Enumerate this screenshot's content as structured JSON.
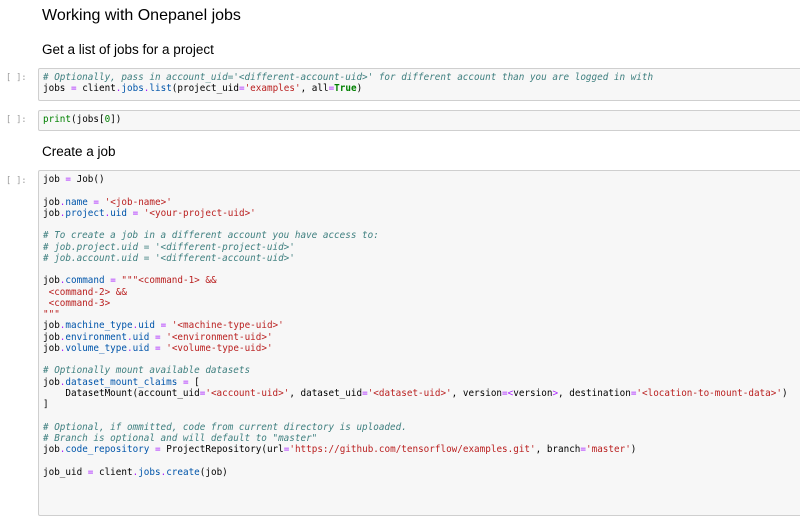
{
  "notebook": {
    "title": "Working with Onepanel jobs",
    "section_list_jobs": "Get a list of jobs for a project",
    "section_create_job": "Create a job",
    "prompt": "[ ]:",
    "cells": [
      {
        "lines": [
          [
            [
              "c",
              "# Optionally, pass in account_uid='<different-account-uid>' for different account than you are logged in with"
            ]
          ],
          [
            [
              "t",
              "jobs "
            ],
            [
              "o",
              "="
            ],
            [
              "t",
              " client"
            ],
            [
              "o",
              "."
            ],
            [
              "a",
              "jobs"
            ],
            [
              "o",
              "."
            ],
            [
              "a",
              "list"
            ],
            [
              "t",
              "(project_uid"
            ],
            [
              "o",
              "="
            ],
            [
              "s",
              "'examples'"
            ],
            [
              "t",
              ", all"
            ],
            [
              "o",
              "="
            ],
            [
              "k",
              "True"
            ],
            [
              "t",
              ")"
            ]
          ]
        ]
      },
      {
        "lines": [
          [
            [
              "b",
              "print"
            ],
            [
              "t",
              "(jobs["
            ],
            [
              "n",
              "0"
            ],
            [
              "t",
              "])"
            ]
          ]
        ]
      },
      {
        "lines": [
          [
            [
              "t",
              "job "
            ],
            [
              "o",
              "="
            ],
            [
              "t",
              " Job()"
            ]
          ],
          [],
          [
            [
              "t",
              "job"
            ],
            [
              "o",
              "."
            ],
            [
              "a",
              "name"
            ],
            [
              "t",
              " "
            ],
            [
              "o",
              "="
            ],
            [
              "t",
              " "
            ],
            [
              "s",
              "'<job-name>'"
            ]
          ],
          [
            [
              "t",
              "job"
            ],
            [
              "o",
              "."
            ],
            [
              "a",
              "project"
            ],
            [
              "o",
              "."
            ],
            [
              "a",
              "uid"
            ],
            [
              "t",
              " "
            ],
            [
              "o",
              "="
            ],
            [
              "t",
              " "
            ],
            [
              "s",
              "'<your-project-uid>'"
            ]
          ],
          [],
          [
            [
              "c",
              "# To create a job in a different account you have access to:"
            ]
          ],
          [
            [
              "c",
              "# job.project.uid = '<different-project-uid>'"
            ]
          ],
          [
            [
              "c",
              "# job.account.uid = '<different-account-uid>'"
            ]
          ],
          [],
          [
            [
              "t",
              "job"
            ],
            [
              "o",
              "."
            ],
            [
              "a",
              "command"
            ],
            [
              "t",
              " "
            ],
            [
              "o",
              "="
            ],
            [
              "t",
              " "
            ],
            [
              "s",
              "\"\"\"<command-1> &&"
            ]
          ],
          [
            [
              "s",
              " <command-2> &&"
            ]
          ],
          [
            [
              "s",
              " <command-3>"
            ]
          ],
          [
            [
              "s",
              "\"\"\""
            ]
          ],
          [
            [
              "t",
              "job"
            ],
            [
              "o",
              "."
            ],
            [
              "a",
              "machine_type"
            ],
            [
              "o",
              "."
            ],
            [
              "a",
              "uid"
            ],
            [
              "t",
              " "
            ],
            [
              "o",
              "="
            ],
            [
              "t",
              " "
            ],
            [
              "s",
              "'<machine-type-uid>'"
            ]
          ],
          [
            [
              "t",
              "job"
            ],
            [
              "o",
              "."
            ],
            [
              "a",
              "environment"
            ],
            [
              "o",
              "."
            ],
            [
              "a",
              "uid"
            ],
            [
              "t",
              " "
            ],
            [
              "o",
              "="
            ],
            [
              "t",
              " "
            ],
            [
              "s",
              "'<environment-uid>'"
            ]
          ],
          [
            [
              "t",
              "job"
            ],
            [
              "o",
              "."
            ],
            [
              "a",
              "volume_type"
            ],
            [
              "o",
              "."
            ],
            [
              "a",
              "uid"
            ],
            [
              "t",
              " "
            ],
            [
              "o",
              "="
            ],
            [
              "t",
              " "
            ],
            [
              "s",
              "'<volume-type-uid>'"
            ]
          ],
          [],
          [
            [
              "c",
              "# Optionally mount available datasets"
            ]
          ],
          [
            [
              "t",
              "job"
            ],
            [
              "o",
              "."
            ],
            [
              "a",
              "dataset_mount_claims"
            ],
            [
              "t",
              " "
            ],
            [
              "o",
              "="
            ],
            [
              "t",
              " ["
            ]
          ],
          [
            [
              "t",
              "    DatasetMount(account_uid"
            ],
            [
              "o",
              "="
            ],
            [
              "s",
              "'<account-uid>'"
            ],
            [
              "t",
              ", dataset_uid"
            ],
            [
              "o",
              "="
            ],
            [
              "s",
              "'<dataset-uid>'"
            ],
            [
              "t",
              ", version"
            ],
            [
              "o",
              "="
            ],
            [
              "o",
              "<"
            ],
            [
              "t",
              "version"
            ],
            [
              "o",
              ">"
            ],
            [
              "t",
              ", destination"
            ],
            [
              "o",
              "="
            ],
            [
              "s",
              "'<location-to-mount-data>'"
            ],
            [
              "t",
              ")"
            ]
          ],
          [
            [
              "t",
              "]"
            ]
          ],
          [],
          [
            [
              "c",
              "# Optional, if ommitted, code from current directory is uploaded."
            ]
          ],
          [
            [
              "c",
              "# Branch is optional and will default to \"master\""
            ]
          ],
          [
            [
              "t",
              "job"
            ],
            [
              "o",
              "."
            ],
            [
              "a",
              "code_repository"
            ],
            [
              "t",
              " "
            ],
            [
              "o",
              "="
            ],
            [
              "t",
              " ProjectRepository(url"
            ],
            [
              "o",
              "="
            ],
            [
              "s",
              "'https://github.com/tensorflow/examples.git'"
            ],
            [
              "t",
              ", branch"
            ],
            [
              "o",
              "="
            ],
            [
              "s",
              "'master'"
            ],
            [
              "t",
              ")"
            ]
          ],
          [],
          [
            [
              "t",
              "job_uid "
            ],
            [
              "o",
              "="
            ],
            [
              "t",
              " client"
            ],
            [
              "o",
              "."
            ],
            [
              "a",
              "jobs"
            ],
            [
              "o",
              "."
            ],
            [
              "a",
              "create"
            ],
            [
              "t",
              "(job)"
            ]
          ]
        ]
      }
    ]
  }
}
